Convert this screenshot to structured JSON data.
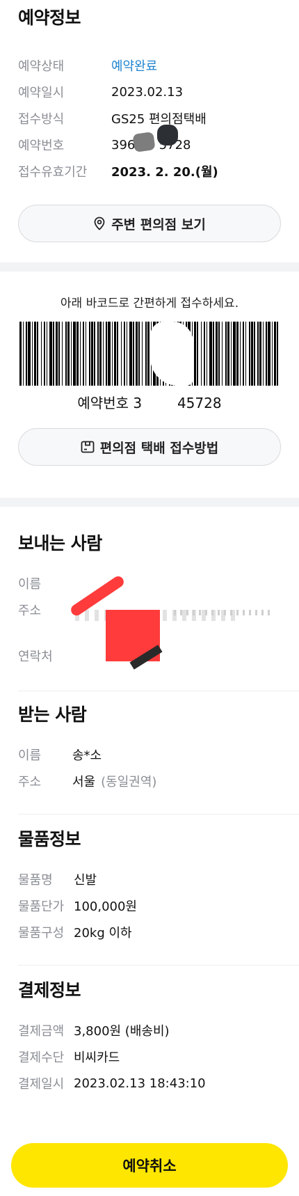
{
  "reservation": {
    "title": "예약정보",
    "rows": [
      {
        "label": "예약상태",
        "value": "예약완료"
      },
      {
        "label": "예약일시",
        "value": "2023.02.13"
      },
      {
        "label": "접수방식",
        "value": "GS25 편의점택배"
      },
      {
        "label": "예약번호",
        "value": "3969    5728"
      },
      {
        "label": "접수유효기간",
        "value": "2023. 2. 20.(월)"
      }
    ],
    "nearby_button": "주변 편의점 보기",
    "status_color": "#1e83cf"
  },
  "barcode": {
    "guide": "아래 바코드로 간편하게 접수하세요.",
    "number_text": "예약번호 3        45728",
    "method_button": "편의점 택배 접수방법"
  },
  "sender": {
    "title": "보내는 사람",
    "name_label": "이름",
    "address_label": "주소",
    "contact_label": "연락처"
  },
  "receiver": {
    "title": "받는 사람",
    "name_label": "이름",
    "name_value": "송*소",
    "address_label": "주소",
    "address_value": "서울",
    "address_note": "(동일권역)"
  },
  "item": {
    "title": "물품정보",
    "rows": [
      {
        "label": "물품명",
        "value": "신발"
      },
      {
        "label": "물품단가",
        "value": "100,000원"
      },
      {
        "label": "물품구성",
        "value": "20kg 이하"
      }
    ]
  },
  "payment": {
    "title": "결제정보",
    "rows": [
      {
        "label": "결제금액",
        "value": "3,800원 (배송비)"
      },
      {
        "label": "결제수단",
        "value": "비씨카드"
      },
      {
        "label": "결제일시",
        "value": "2023.02.13 18:43:10"
      }
    ]
  },
  "cancel_button": "예약취소",
  "accent_color": "#ffe600"
}
